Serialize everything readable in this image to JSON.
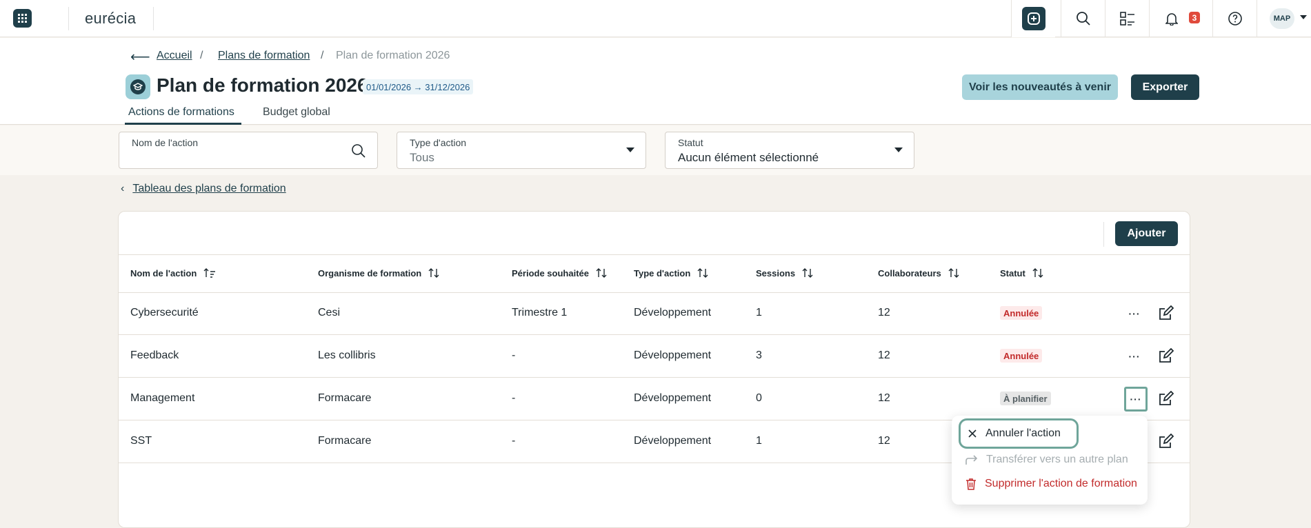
{
  "topbar": {
    "logo_text": "eurécia",
    "notification_count": "3",
    "avatar_initials": "MAP"
  },
  "breadcrumb": {
    "home": "Accueil",
    "plans": "Plans de formation",
    "current": "Plan de formation 2026",
    "separator": "/"
  },
  "header": {
    "title": "Plan de formation 2026",
    "date_range": "01/01/2026 → 31/12/2026",
    "news_button": "Voir les nouveautés à venir",
    "export_button": "Exporter"
  },
  "tabs": [
    {
      "label": "Actions de formations",
      "active": true
    },
    {
      "label": "Budget global",
      "active": false
    }
  ],
  "filters": {
    "name": {
      "label": "Nom de l'action",
      "value": ""
    },
    "type": {
      "label": "Type d'action",
      "value": "Tous"
    },
    "status": {
      "label": "Statut",
      "value": "Aucun élément sélectionné"
    }
  },
  "back_link": "Tableau des plans de formation",
  "table": {
    "add_button": "Ajouter",
    "columns": [
      "Nom de l'action",
      "Organisme de formation",
      "Période souhaitée",
      "Type d'action",
      "Sessions",
      "Collaborateurs",
      "Statut"
    ],
    "rows": [
      {
        "name": "Cybersecurité",
        "org": "Cesi",
        "period": "Trimestre 1",
        "type": "Développement",
        "sessions": "1",
        "collab": "12",
        "status": "Annulée"
      },
      {
        "name": "Feedback",
        "org": "Les collibris",
        "period": "-",
        "type": "Développement",
        "sessions": "3",
        "collab": "12",
        "status": "Annulée"
      },
      {
        "name": "Management",
        "org": "Formacare",
        "period": "-",
        "type": "Développement",
        "sessions": "0",
        "collab": "12",
        "status": "À planifier"
      },
      {
        "name": "SST",
        "org": "Formacare",
        "period": "-",
        "type": "Développement",
        "sessions": "1",
        "collab": "12",
        "status": ""
      }
    ]
  },
  "row_menu": {
    "cancel": "Annuler l'action",
    "transfer": "Transférer vers un autre plan",
    "delete": "Supprimer l'action de formation"
  },
  "colors": {
    "primary": "#1f3f4a",
    "accent_light": "#a8d4dc",
    "danger": "#c22b2b",
    "focus": "#6fa59a"
  }
}
